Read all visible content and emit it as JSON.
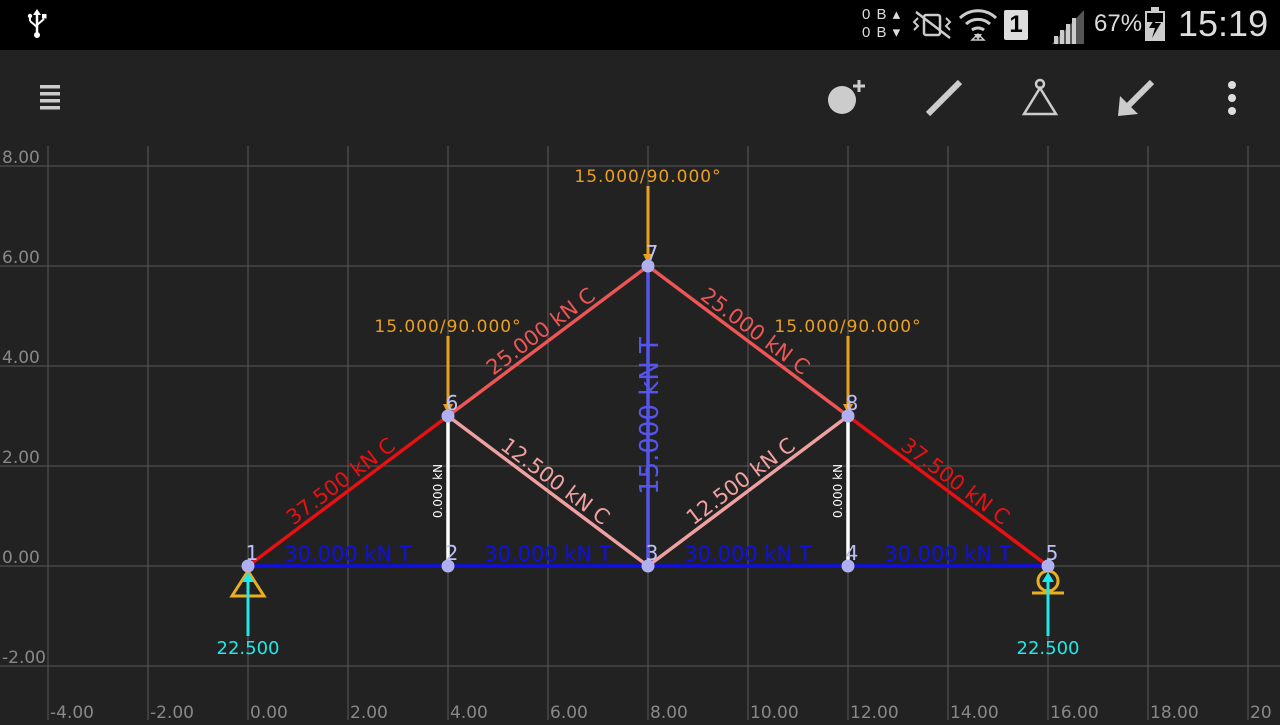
{
  "status_bar": {
    "time": "15:19",
    "battery_percent": "67%",
    "data_up": "0 B",
    "data_down": "0 B",
    "sim_slot": "1",
    "icons": [
      "usb-icon",
      "data-activity-icon",
      "vibrate-mute-icon",
      "wifi-icon",
      "sim-icon",
      "signal-icon",
      "battery-charging-icon"
    ]
  },
  "toolbar": {
    "icons": [
      "menu-icon",
      "add-node-icon",
      "add-member-icon",
      "add-support-icon",
      "add-load-icon",
      "more-options-icon"
    ]
  },
  "plot": {
    "x_ticks": [
      "-4.00",
      "-2.00",
      "0.00",
      "2.00",
      "4.00",
      "6.00",
      "8.00",
      "10.00",
      "12.00",
      "14.00",
      "16.00",
      "18.00",
      "20"
    ],
    "y_ticks": [
      "8.00",
      "6.00",
      "4.00",
      "2.00",
      "0.00",
      "-2.00"
    ],
    "x_range": [
      -4,
      20
    ],
    "y_range": [
      -2,
      8
    ],
    "grid": true
  },
  "truss": {
    "nodes": [
      {
        "id": "1",
        "x": 0,
        "y": 0
      },
      {
        "id": "2",
        "x": 4,
        "y": 0
      },
      {
        "id": "3",
        "x": 8,
        "y": 0
      },
      {
        "id": "4",
        "x": 12,
        "y": 0
      },
      {
        "id": "5",
        "x": 16,
        "y": 0
      },
      {
        "id": "6",
        "x": 4,
        "y": 3
      },
      {
        "id": "7",
        "x": 8,
        "y": 6
      },
      {
        "id": "8",
        "x": 12,
        "y": 3
      }
    ],
    "members": [
      {
        "from": "1",
        "to": "2",
        "label": "30.000 kN T",
        "color": "#1010e0"
      },
      {
        "from": "2",
        "to": "3",
        "label": "30.000 kN T",
        "color": "#1010e0"
      },
      {
        "from": "3",
        "to": "4",
        "label": "30.000 kN T",
        "color": "#1010e0"
      },
      {
        "from": "4",
        "to": "5",
        "label": "30.000 kN T",
        "color": "#1010e0"
      },
      {
        "from": "1",
        "to": "6",
        "label": "37.500 kN C",
        "color": "#e81010"
      },
      {
        "from": "6",
        "to": "7",
        "label": "25.000 kN C",
        "color": "#ee5555"
      },
      {
        "from": "7",
        "to": "8",
        "label": "25.000 kN C",
        "color": "#ee5555"
      },
      {
        "from": "8",
        "to": "5",
        "label": "37.500 kN C",
        "color": "#e81010"
      },
      {
        "from": "6",
        "to": "3",
        "label": "12.500 kN C",
        "color": "#f0a0a0"
      },
      {
        "from": "3",
        "to": "8",
        "label": "12.500 kN C",
        "color": "#f0a0a0"
      },
      {
        "from": "2",
        "to": "6",
        "label": "0.000 kN",
        "color": "#ffffff"
      },
      {
        "from": "4",
        "to": "8",
        "label": "0.000 kN",
        "color": "#ffffff"
      },
      {
        "from": "3",
        "to": "7",
        "label": "15.000 kN T",
        "color": "#5555ee"
      }
    ],
    "loads": [
      {
        "node": "6",
        "label": "15.000/90.000°"
      },
      {
        "node": "7",
        "label": "15.000/90.000°"
      },
      {
        "node": "8",
        "label": "15.000/90.000°"
      }
    ],
    "supports": [
      {
        "node": "1",
        "type": "pin",
        "reaction": "22.500"
      },
      {
        "node": "5",
        "type": "roller",
        "reaction": "22.500"
      }
    ],
    "colors": {
      "node": "#b0b0f0",
      "node_label": "#c0c0f8",
      "load": "#e8a020",
      "reaction": "#20e8e8",
      "support": "#e8b020",
      "grid": "#5a5a5a",
      "tick": "#888888"
    }
  }
}
